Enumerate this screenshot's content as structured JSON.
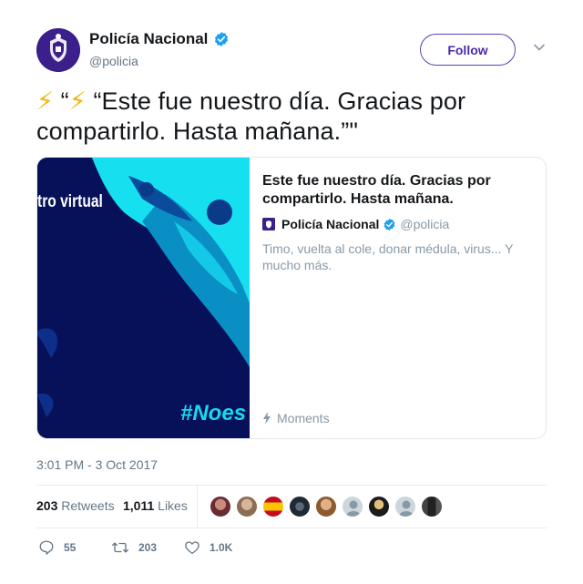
{
  "user": {
    "name": "Policía Nacional",
    "handle": "@policia",
    "follow_label": "Follow"
  },
  "tweet": {
    "text_line1": "“Este fue nuestro día. Gracias por",
    "text_line2": "compartirlo. Hasta mañana.”\"",
    "quote_open": "“"
  },
  "card": {
    "image_text_top": "tro virtual",
    "image_text_bottom": "#Noes",
    "title": "Este fue nuestro día. Gracias por compartirlo. Hasta mañana.",
    "author_name": "Policía Nacional",
    "author_handle": "@policia",
    "description": "Timo, vuelta al cole, donar médula, virus... Y mucho más.",
    "moments_label": "Moments"
  },
  "timestamp": "3:01 PM - 3 Oct 2017",
  "stats": {
    "retweets_count": "203",
    "retweets_label": "Retweets",
    "likes_count": "1,011",
    "likes_label": "Likes"
  },
  "actions": {
    "replies": "55",
    "retweets": "203",
    "likes": "1.0K"
  },
  "colors": {
    "verified": "#1da1f2",
    "follow_border": "#5c3fb5",
    "card_image_bg": "#06115a",
    "card_image_accent": "#16e0f0"
  }
}
